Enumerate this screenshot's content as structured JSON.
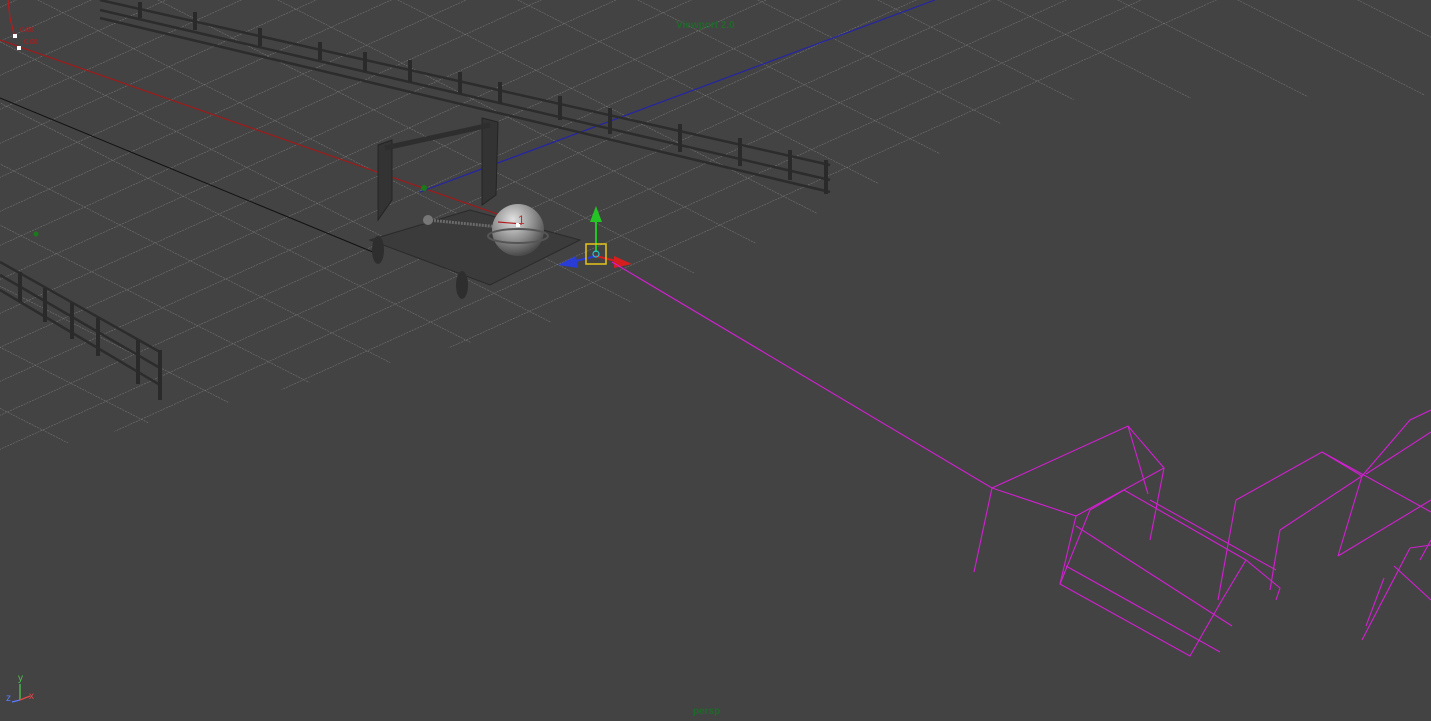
{
  "viewport": {
    "renderer_label": "Viewport 2.0",
    "camera_label": "persp",
    "background_color": "#434343",
    "grid_color": "#9a9a9a",
    "wireframe_color": "#d21fd2"
  },
  "axis_indicator": {
    "y_label": "y",
    "x_label": "x",
    "z_label": "z",
    "x_color": "#e04848",
    "y_color": "#4ec24e",
    "z_color": "#5a7cff"
  },
  "scene": {
    "selected_object": "catapult",
    "move_manipulator": {
      "x_axis_color": "#d61e1e",
      "y_axis_color": "#24c424",
      "z_axis_color": "#2a3cd6",
      "center_color": "#e6c418"
    },
    "locator_label": "1"
  }
}
